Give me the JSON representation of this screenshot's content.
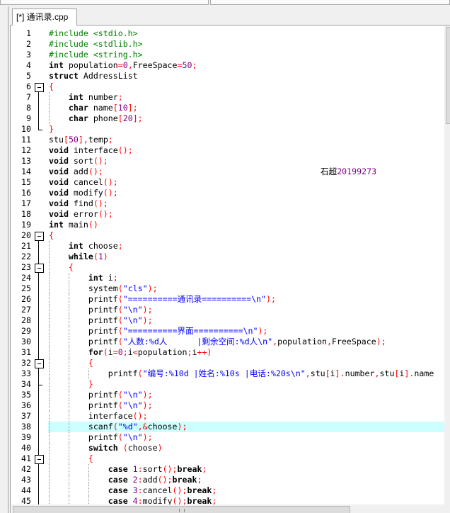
{
  "tab": {
    "label": "[*] 通讯录.cpp"
  },
  "annotation": {
    "name": "石超",
    "student_id": "20199273"
  },
  "editor": {
    "syntax_colors": {
      "pp": "#008000",
      "kw": "#000000",
      "num": "#800080",
      "str": "#0000ff",
      "sym": "#ff0000",
      "id": "#000000"
    },
    "current_line_color": "#ccffff",
    "lines": [
      {
        "n": 1,
        "t": [
          {
            "pp": "#include <stdio.h>"
          }
        ]
      },
      {
        "n": 2,
        "t": [
          {
            "pp": "#include <stdlib.h>"
          }
        ]
      },
      {
        "n": 3,
        "t": [
          {
            "pp": "#include <string.h>"
          }
        ]
      },
      {
        "n": 4,
        "t": [
          {
            "kw": "int"
          },
          {
            "id": " population"
          },
          {
            "sym": "="
          },
          {
            "num": "0"
          },
          {
            "sym": ","
          },
          {
            "id": "FreeSpace"
          },
          {
            "sym": "="
          },
          {
            "num": "50"
          },
          {
            "sym": ";"
          }
        ]
      },
      {
        "n": 5,
        "t": [
          {
            "kw": "struct"
          },
          {
            "id": " AddressList"
          }
        ]
      },
      {
        "n": 6,
        "fold_start": true,
        "t": [
          {
            "sym": "{"
          }
        ]
      },
      {
        "n": 7,
        "t": [
          {
            "id": "    "
          },
          {
            "kw": "int"
          },
          {
            "id": " number"
          },
          {
            "sym": ";"
          }
        ]
      },
      {
        "n": 8,
        "t": [
          {
            "id": "    "
          },
          {
            "kw": "char"
          },
          {
            "id": " name"
          },
          {
            "sym": "["
          },
          {
            "num": "10"
          },
          {
            "sym": "];"
          }
        ]
      },
      {
        "n": 9,
        "t": [
          {
            "id": "    "
          },
          {
            "kw": "char"
          },
          {
            "id": " phone"
          },
          {
            "sym": "["
          },
          {
            "num": "20"
          },
          {
            "sym": "];"
          }
        ]
      },
      {
        "n": 10,
        "fold_end": true,
        "t": [
          {
            "sym": "}"
          }
        ]
      },
      {
        "n": 11,
        "t": [
          {
            "id": "stu"
          },
          {
            "sym": "["
          },
          {
            "num": "50"
          },
          {
            "sym": "],"
          },
          {
            "id": "temp"
          },
          {
            "sym": ";"
          }
        ]
      },
      {
        "n": 12,
        "t": [
          {
            "kw": "void"
          },
          {
            "id": " interface"
          },
          {
            "sym": "();"
          }
        ]
      },
      {
        "n": 13,
        "t": [
          {
            "kw": "void"
          },
          {
            "id": " sort"
          },
          {
            "sym": "();"
          }
        ]
      },
      {
        "n": 14,
        "t": [
          {
            "kw": "void"
          },
          {
            "id": " add"
          },
          {
            "sym": "();"
          }
        ]
      },
      {
        "n": 15,
        "t": [
          {
            "kw": "void"
          },
          {
            "id": " cancel"
          },
          {
            "sym": "();"
          }
        ]
      },
      {
        "n": 16,
        "t": [
          {
            "kw": "void"
          },
          {
            "id": " modify"
          },
          {
            "sym": "();"
          }
        ]
      },
      {
        "n": 17,
        "t": [
          {
            "kw": "void"
          },
          {
            "id": " find"
          },
          {
            "sym": "();"
          }
        ]
      },
      {
        "n": 18,
        "t": [
          {
            "kw": "void"
          },
          {
            "id": " error"
          },
          {
            "sym": "();"
          }
        ]
      },
      {
        "n": 19,
        "t": [
          {
            "kw": "int"
          },
          {
            "id": " main"
          },
          {
            "sym": "()"
          }
        ]
      },
      {
        "n": 20,
        "fold_start": true,
        "t": [
          {
            "sym": "{"
          }
        ]
      },
      {
        "n": 21,
        "t": [
          {
            "id": "    "
          },
          {
            "kw": "int"
          },
          {
            "id": " choose"
          },
          {
            "sym": ";"
          }
        ]
      },
      {
        "n": 22,
        "t": [
          {
            "id": "    "
          },
          {
            "kw": "while"
          },
          {
            "sym": "("
          },
          {
            "num": "1"
          },
          {
            "sym": ")"
          }
        ]
      },
      {
        "n": 23,
        "fold_start": true,
        "t": [
          {
            "id": "    "
          },
          {
            "sym": "{"
          }
        ]
      },
      {
        "n": 24,
        "t": [
          {
            "id": "        "
          },
          {
            "kw": "int"
          },
          {
            "id": " i"
          },
          {
            "sym": ";"
          }
        ]
      },
      {
        "n": 25,
        "t": [
          {
            "id": "        system"
          },
          {
            "sym": "("
          },
          {
            "str": "\"cls\""
          },
          {
            "sym": ");"
          }
        ]
      },
      {
        "n": 26,
        "t": [
          {
            "id": "        printf"
          },
          {
            "sym": "("
          },
          {
            "str": "\"==========通讯录==========\\n\""
          },
          {
            "sym": ");"
          }
        ]
      },
      {
        "n": 27,
        "t": [
          {
            "id": "        printf"
          },
          {
            "sym": "("
          },
          {
            "str": "\"\\n\""
          },
          {
            "sym": ");"
          }
        ]
      },
      {
        "n": 28,
        "t": [
          {
            "id": "        printf"
          },
          {
            "sym": "("
          },
          {
            "str": "\"\\n\""
          },
          {
            "sym": ");"
          }
        ]
      },
      {
        "n": 29,
        "t": [
          {
            "id": "        printf"
          },
          {
            "sym": "("
          },
          {
            "str": "\"==========界面==========\\n\""
          },
          {
            "sym": ");"
          }
        ]
      },
      {
        "n": 30,
        "t": [
          {
            "id": "        printf"
          },
          {
            "sym": "("
          },
          {
            "str": "\"人数:%d人      |剩余空间:%d人\\n\""
          },
          {
            "sym": ","
          },
          {
            "id": "population"
          },
          {
            "sym": ","
          },
          {
            "id": "FreeSpace"
          },
          {
            "sym": ");"
          }
        ]
      },
      {
        "n": 31,
        "t": [
          {
            "id": "        "
          },
          {
            "kw": "for"
          },
          {
            "sym": "("
          },
          {
            "id": "i"
          },
          {
            "sym": "="
          },
          {
            "num": "0"
          },
          {
            "sym": ";"
          },
          {
            "id": "i"
          },
          {
            "sym": "<"
          },
          {
            "id": "population"
          },
          {
            "sym": ";"
          },
          {
            "id": "i"
          },
          {
            "sym": "++)"
          }
        ]
      },
      {
        "n": 32,
        "fold_start": true,
        "t": [
          {
            "id": "        "
          },
          {
            "sym": "{"
          }
        ]
      },
      {
        "n": 33,
        "t": [
          {
            "id": "            printf"
          },
          {
            "sym": "("
          },
          {
            "str": "\"编号:%10d |姓名:%10s |电话:%20s\\n\""
          },
          {
            "sym": ","
          },
          {
            "id": "stu"
          },
          {
            "sym": "["
          },
          {
            "id": "i"
          },
          {
            "sym": "]."
          },
          {
            "id": "number"
          },
          {
            "sym": ","
          },
          {
            "id": "stu"
          },
          {
            "sym": "["
          },
          {
            "id": "i"
          },
          {
            "sym": "]."
          },
          {
            "id": "name"
          }
        ]
      },
      {
        "n": 34,
        "fold_end": true,
        "t": [
          {
            "id": "        "
          },
          {
            "sym": "}"
          }
        ]
      },
      {
        "n": 35,
        "t": [
          {
            "id": "        printf"
          },
          {
            "sym": "("
          },
          {
            "str": "\"\\n\""
          },
          {
            "sym": ");"
          }
        ]
      },
      {
        "n": 36,
        "t": [
          {
            "id": "        printf"
          },
          {
            "sym": "("
          },
          {
            "str": "\"\\n\""
          },
          {
            "sym": ");"
          }
        ]
      },
      {
        "n": 37,
        "t": [
          {
            "id": "        interface"
          },
          {
            "sym": "();"
          }
        ]
      },
      {
        "n": 38,
        "current": true,
        "t": [
          {
            "id": "        scanf"
          },
          {
            "sym": "("
          },
          {
            "str": "\"%d\""
          },
          {
            "sym": ",&"
          },
          {
            "id": "choose"
          },
          {
            "sym": ");"
          }
        ]
      },
      {
        "n": 39,
        "t": [
          {
            "id": "        printf"
          },
          {
            "sym": "("
          },
          {
            "str": "\"\\n\""
          },
          {
            "sym": ");"
          }
        ]
      },
      {
        "n": 40,
        "t": [
          {
            "id": "        "
          },
          {
            "kw": "switch"
          },
          {
            "id": " "
          },
          {
            "sym": "("
          },
          {
            "id": "choose"
          },
          {
            "sym": ")"
          }
        ]
      },
      {
        "n": 41,
        "fold_start": true,
        "t": [
          {
            "id": "        "
          },
          {
            "sym": "{"
          }
        ]
      },
      {
        "n": 42,
        "t": [
          {
            "id": "            "
          },
          {
            "kw": "case"
          },
          {
            "id": " "
          },
          {
            "num": "1"
          },
          {
            "sym": ":"
          },
          {
            "id": "sort"
          },
          {
            "sym": "();"
          },
          {
            "kw": "break"
          },
          {
            "sym": ";"
          }
        ]
      },
      {
        "n": 43,
        "t": [
          {
            "id": "            "
          },
          {
            "kw": "case"
          },
          {
            "id": " "
          },
          {
            "num": "2"
          },
          {
            "sym": ":"
          },
          {
            "id": "add"
          },
          {
            "sym": "();"
          },
          {
            "kw": "break"
          },
          {
            "sym": ";"
          }
        ]
      },
      {
        "n": 44,
        "t": [
          {
            "id": "            "
          },
          {
            "kw": "case"
          },
          {
            "id": " "
          },
          {
            "num": "3"
          },
          {
            "sym": ":"
          },
          {
            "id": "cancel"
          },
          {
            "sym": "();"
          },
          {
            "kw": "break"
          },
          {
            "sym": ";"
          }
        ]
      },
      {
        "n": 45,
        "t": [
          {
            "id": "            "
          },
          {
            "kw": "case"
          },
          {
            "id": " "
          },
          {
            "num": "4"
          },
          {
            "sym": ":"
          },
          {
            "id": "modify"
          },
          {
            "sym": "();"
          },
          {
            "kw": "break"
          },
          {
            "sym": ";"
          }
        ]
      }
    ]
  }
}
